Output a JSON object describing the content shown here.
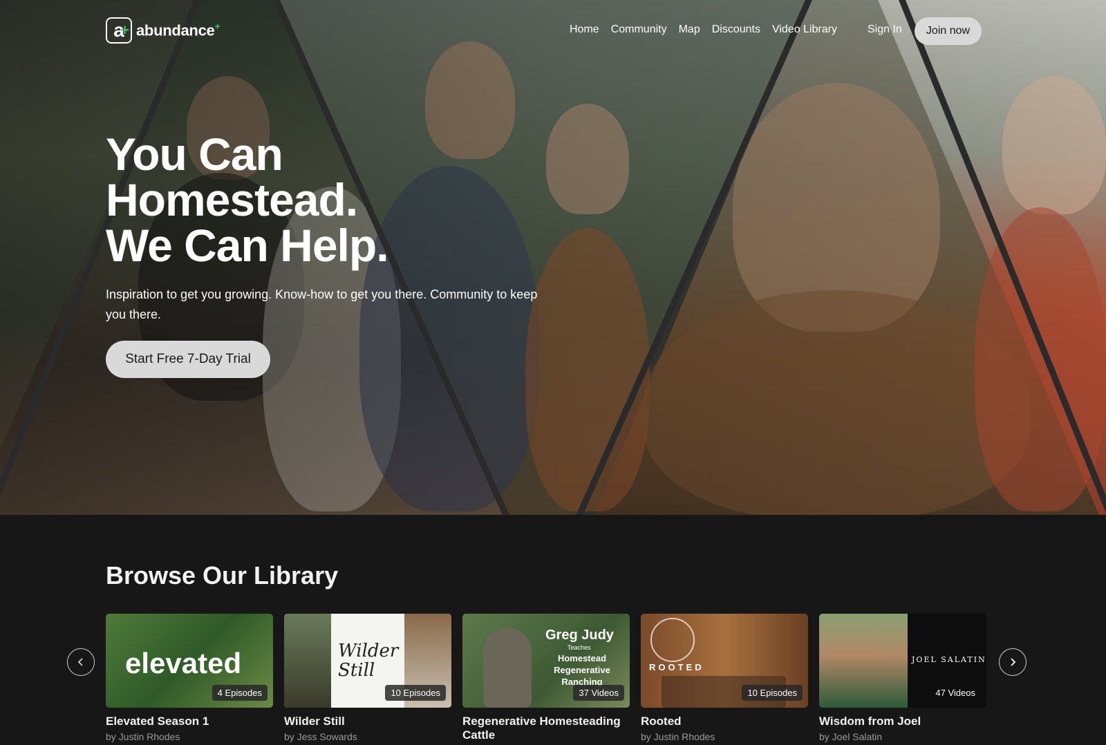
{
  "brand": {
    "logo_letter": "a",
    "name": "abundance",
    "plus": "+"
  },
  "nav": {
    "items": [
      "Home",
      "Community",
      "Map",
      "Discounts",
      "Video Library"
    ],
    "sign_in": "Sign In",
    "join": "Join now"
  },
  "hero": {
    "headline": [
      "You Can",
      "Homestead.",
      "We Can Help."
    ],
    "subtitle": "Inspiration to get you growing. Know-how to get you there. Community to keep you there.",
    "cta": "Start Free 7-Day Trial"
  },
  "library": {
    "title": "Browse Our Library",
    "cards": [
      {
        "title": "Elevated Season 1",
        "author": "by Justin Rhodes",
        "badge": "4 Episodes",
        "thumb_text": "elevated"
      },
      {
        "title": "Wilder Still",
        "author": "by Jess Sowards",
        "badge": "10 Episodes",
        "thumb_text": "Wilder Still"
      },
      {
        "title": "Regenerative Homesteading Cattle",
        "author": "",
        "badge": "37 Videos",
        "thumb_text": "Greg Judy",
        "thumb_sub": "Teaches",
        "thumb_line": "Homestead Regenerative Ranching"
      },
      {
        "title": "Rooted",
        "author": "by Justin Rhodes",
        "badge": "10 Episodes",
        "thumb_text": "ROOTED"
      },
      {
        "title": "Wisdom from Joel",
        "author": "by Joel Salatin",
        "badge": "47 Videos",
        "thumb_text": "JOEL SALATIN"
      }
    ]
  },
  "colors": {
    "accent": "#38c172",
    "background": "#171717",
    "button": "#d9d9d9"
  }
}
